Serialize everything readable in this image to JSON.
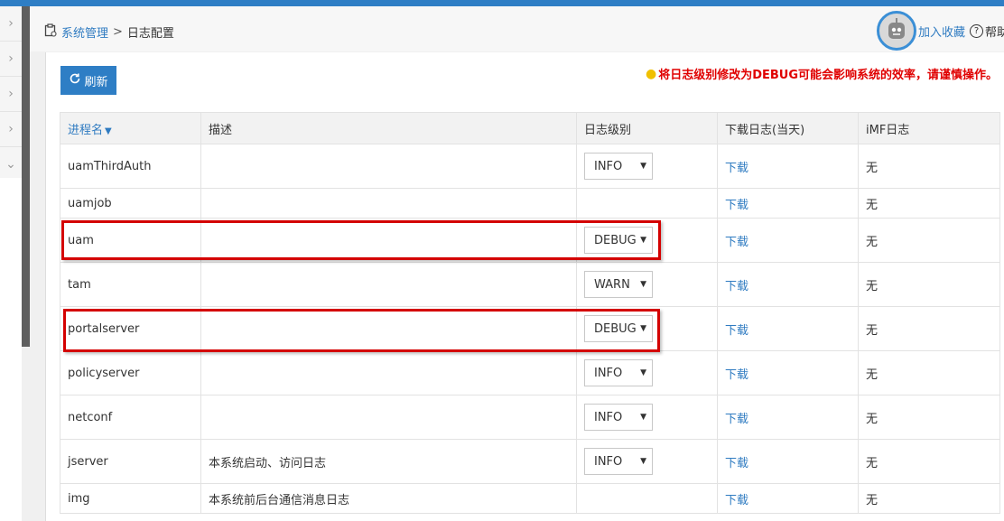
{
  "breadcrumb": {
    "parent": "系统管理",
    "separator": ">",
    "current": "日志配置"
  },
  "header": {
    "favorite_label": "加入收藏",
    "help_label": "帮助"
  },
  "toolbar": {
    "refresh_label": "刷新"
  },
  "warning_text": "将日志级别修改为DEBUG可能会影响系统的效率，请谨慎操作。",
  "table": {
    "columns": [
      "进程名",
      "描述",
      "日志级别",
      "下载日志(当天)",
      "iMF日志"
    ],
    "sort_column": "进程名",
    "rows": [
      {
        "process": "uamThirdAuth",
        "desc": "",
        "level": "INFO",
        "download": "下载",
        "imf": "无",
        "highlighted": false
      },
      {
        "process": "uamjob",
        "desc": "",
        "level": "",
        "download": "下载",
        "imf": "无",
        "highlighted": false
      },
      {
        "process": "uam",
        "desc": "",
        "level": "DEBUG",
        "download": "下载",
        "imf": "无",
        "highlighted": true
      },
      {
        "process": "tam",
        "desc": "",
        "level": "WARN",
        "download": "下载",
        "imf": "无",
        "highlighted": false
      },
      {
        "process": "portalserver",
        "desc": "",
        "level": "DEBUG",
        "download": "下载",
        "imf": "无",
        "highlighted": true
      },
      {
        "process": "policyserver",
        "desc": "",
        "level": "INFO",
        "download": "下载",
        "imf": "无",
        "highlighted": false
      },
      {
        "process": "netconf",
        "desc": "",
        "level": "INFO",
        "download": "下载",
        "imf": "无",
        "highlighted": false
      },
      {
        "process": "jserver",
        "desc": "本系统启动、访问日志",
        "level": "INFO",
        "download": "下载",
        "imf": "无",
        "highlighted": false
      },
      {
        "process": "img",
        "desc": "本系统前后台通信消息日志",
        "level": "",
        "download": "下载",
        "imf": "无",
        "highlighted": false
      }
    ]
  },
  "colors": {
    "accent": "#2e7ec5",
    "link": "#2f7bc1",
    "warning": "#e00000",
    "highlight": "#d40000"
  }
}
